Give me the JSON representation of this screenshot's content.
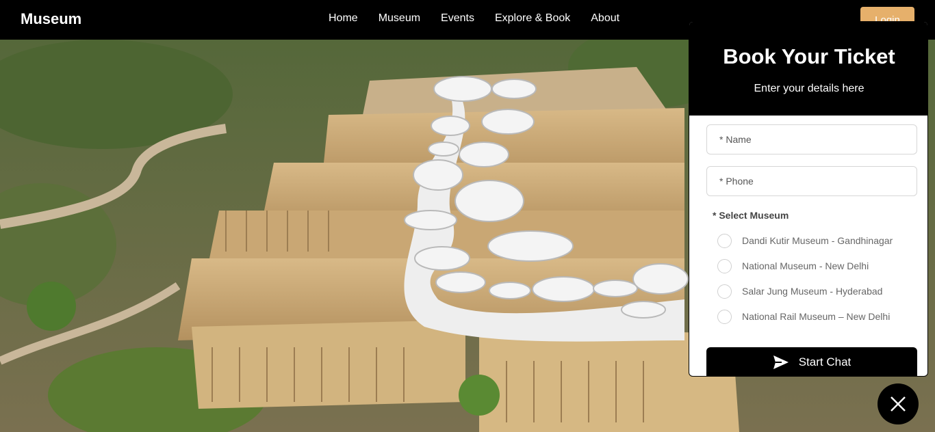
{
  "nav": {
    "brand": "Museum",
    "links": [
      "Home",
      "Museum",
      "Events",
      "Explore & Book",
      "About"
    ],
    "login_label": "Login"
  },
  "hero": {
    "image_icon": "aerial-museum-photo"
  },
  "booking": {
    "title": "Book Your Ticket",
    "subtitle": "Enter your details here",
    "name_placeholder": "* Name",
    "phone_placeholder": "* Phone",
    "select_label": "* Select Museum",
    "museums": [
      "Dandi Kutir Museum - Gandhinagar",
      "National Museum - New Delhi",
      "Salar Jung Museum - Hyderabad",
      "National Rail Museum – New Delhi"
    ],
    "start_chat_label": "Start Chat"
  },
  "colors": {
    "accent": "#e6b06b",
    "dark": "#000000"
  },
  "icons": {
    "send": "send-icon",
    "close": "close-icon"
  }
}
